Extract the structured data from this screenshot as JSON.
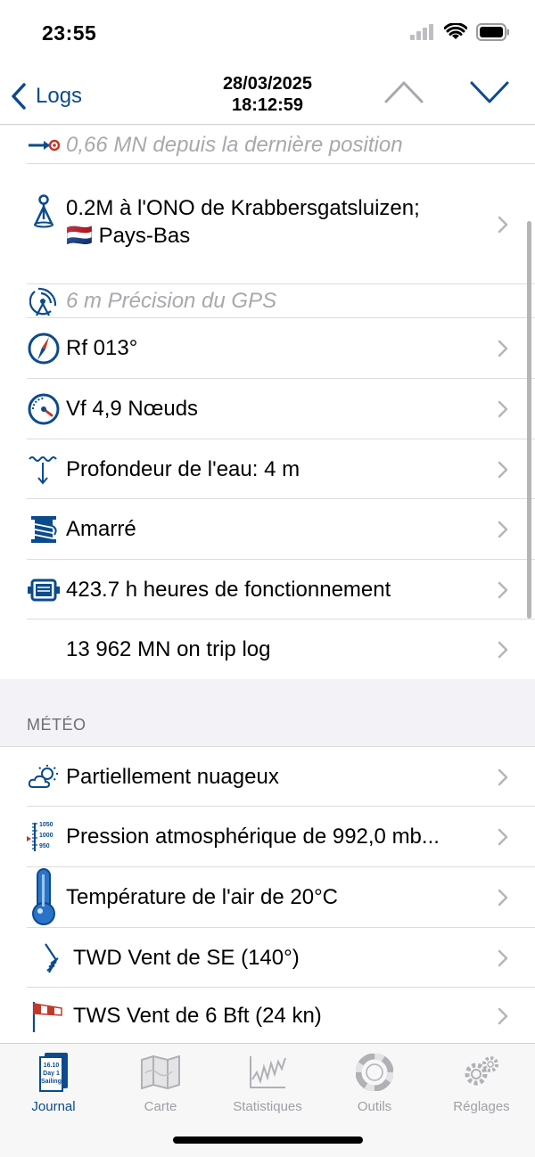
{
  "status": {
    "time": "23:55"
  },
  "nav": {
    "back_label": "Logs",
    "date": "28/03/2025",
    "time": "18:12:59"
  },
  "entries": [
    {
      "icon": "distance-icon",
      "text": "0,66 MN depuis la dernière position",
      "style": "gray"
    },
    {
      "icon": "location-pin-icon",
      "line1": "0.2M à l'ONO de Krabbersgatsluizen;",
      "flag": "🇳🇱",
      "line2": "Pays-Bas"
    },
    {
      "icon": "gps-antenna-icon",
      "text": "6 m Précision du GPS",
      "style": "gray"
    },
    {
      "icon": "compass-icon",
      "text": "Rf 013°"
    },
    {
      "icon": "speedometer-icon",
      "text": "Vf 4,9 Nœuds"
    },
    {
      "icon": "depth-icon",
      "text": "Profondeur de l'eau: 4 m"
    },
    {
      "icon": "mooring-icon",
      "text": "Amarré"
    },
    {
      "icon": "engine-icon",
      "text": "423.7 h heures de fonctionnement"
    },
    {
      "icon": "",
      "text": "13 962 MN on trip log"
    }
  ],
  "weather": {
    "header": "MÉTÉO",
    "items": [
      {
        "icon": "partly-cloudy-icon",
        "text": "Partiellement nuageux"
      },
      {
        "icon": "barometer-icon",
        "text": "Pression atmosphérique de 992,0 mb...",
        "scale": [
          "1050",
          "1000",
          "950"
        ]
      },
      {
        "icon": "thermometer-icon",
        "text": "Température de l'air de 20°C"
      },
      {
        "icon": "wind-direction-icon",
        "text": "TWD Vent de SE (140°)"
      },
      {
        "icon": "windsock-icon",
        "text": "TWS Vent de 6 Bft (24 kn)"
      }
    ]
  },
  "tabs": [
    {
      "label": "Journal",
      "active": true,
      "icon_text": [
        "16.10",
        "Day 1",
        "Sailing"
      ]
    },
    {
      "label": "Carte"
    },
    {
      "label": "Statistiques"
    },
    {
      "label": "Outils"
    },
    {
      "label": "Réglages"
    }
  ],
  "colors": {
    "accent": "#0b4b8c",
    "red": "#c0392b",
    "gray_text": "#a8a8ad"
  }
}
